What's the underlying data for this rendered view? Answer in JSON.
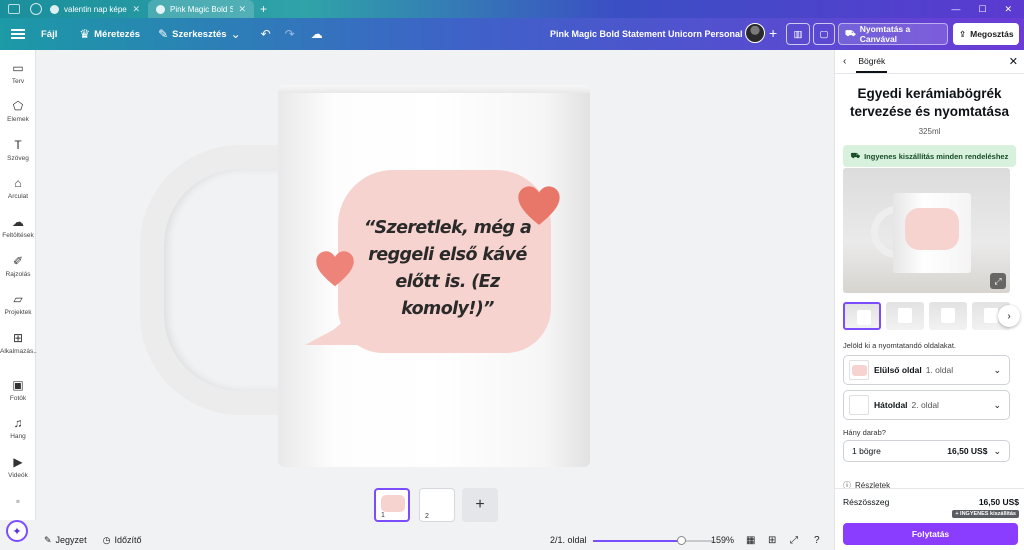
{
  "browser": {
    "tabs": [
      {
        "label": "valentin nap képek..."
      },
      {
        "label": "Pink Magic Bold St..."
      }
    ]
  },
  "toolbar": {
    "file": "Fájl",
    "resize": "Méretezés",
    "edit": "Szerkesztés",
    "title": "Pink Magic Bold Statement Unicorn Personal Mug",
    "print": "Nyomtatás a Canvával",
    "share": "Megosztás"
  },
  "sidebar": {
    "items": [
      {
        "label": "Terv",
        "icon": "layout-icon"
      },
      {
        "label": "Elemek",
        "icon": "elements-icon"
      },
      {
        "label": "Szöveg",
        "icon": "text-icon"
      },
      {
        "label": "Arculat",
        "icon": "brand-icon"
      },
      {
        "label": "Feltöltések",
        "icon": "upload-icon"
      },
      {
        "label": "Rajzolás",
        "icon": "draw-icon"
      },
      {
        "label": "Projektek",
        "icon": "folder-icon"
      },
      {
        "label": "Alkalmazás...",
        "icon": "apps-icon"
      },
      {
        "label": "Fotók",
        "icon": "photo-icon"
      },
      {
        "label": "Hang",
        "icon": "music-icon"
      },
      {
        "label": "Videók",
        "icon": "video-icon"
      }
    ]
  },
  "canvas": {
    "quote": "“Szeretlek, még a reggeli első kávé előtt is. (Ez komoly!)”",
    "colors": {
      "bubble": "#f7d3cf",
      "heart": "#e8776a"
    }
  },
  "pages": {
    "thumbs": [
      "1",
      "2"
    ]
  },
  "bottombar": {
    "notes": "Jegyzet",
    "timer": "Időzítő",
    "page_indicator": "2/1. oldal",
    "zoom": "159%",
    "zoom_level": 0.73
  },
  "panel": {
    "breadcrumb": "Bögrék",
    "title": "Egyedi kerámiabögrék tervezése és nyomtatása",
    "size": "325ml",
    "shipping": "Ingyenes kiszállítás minden rendeléshez",
    "sides_label": "Jelöld ki a nyomtatandó oldalakat.",
    "front": {
      "name": "Elülső oldal",
      "page": "1. oldal"
    },
    "back": {
      "name": "Hátoldal",
      "page": "2. oldal"
    },
    "qty_label": "Hány darab?",
    "qty": "1 bögre",
    "qty_price": "16,50 US$",
    "details": "Részletek",
    "subtotal_label": "Részösszeg",
    "subtotal_price": "16,50 US$",
    "free_tag": "+ INGYENES kiszállítás",
    "continue": "Folytatás",
    "accent": "#8b3dff"
  }
}
